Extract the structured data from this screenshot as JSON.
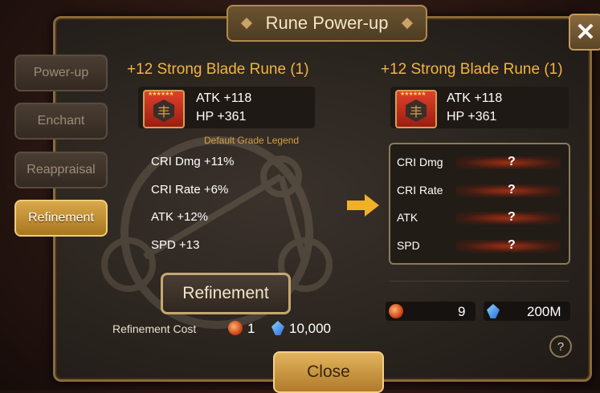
{
  "window": {
    "title": "Rune Power-up",
    "close_icon": "close-icon"
  },
  "tabs": [
    {
      "label": "Power-up",
      "active": false
    },
    {
      "label": "Enchant",
      "active": false
    },
    {
      "label": "Reappraisal",
      "active": false
    },
    {
      "label": "Refinement",
      "active": true
    }
  ],
  "current_rune": {
    "name": "+12 Strong Blade Rune (1)",
    "stars": "★★★★★★",
    "main_stats": [
      "ATK +118",
      "HP +361"
    ],
    "grade_legend": "Default Grade Legend",
    "sub_stats": [
      "CRI Dmg +11%",
      "CRI Rate +6%",
      "ATK +12%",
      "SPD +13"
    ]
  },
  "refine_button": "Refinement",
  "cost": {
    "label": "Refinement Cost",
    "swirl_amount": "1",
    "crystal_amount": "10,000"
  },
  "result_rune": {
    "name": "+12 Strong Blade Rune (1)",
    "stars": "★★★★★★",
    "main_stats": [
      "ATK +118",
      "HP +361"
    ],
    "sub_stats": [
      {
        "label": "CRI Dmg",
        "value": "?"
      },
      {
        "label": "CRI Rate",
        "value": "?"
      },
      {
        "label": "ATK",
        "value": "?"
      },
      {
        "label": "SPD",
        "value": "?"
      }
    ]
  },
  "inventory": {
    "swirl_count": "9",
    "crystal_count": "200M"
  },
  "help_label": "?",
  "close_button": "Close",
  "colors": {
    "accent_gold": "#f0b540",
    "active_tab": "#d9a84a",
    "arrow": "#f0b028"
  }
}
